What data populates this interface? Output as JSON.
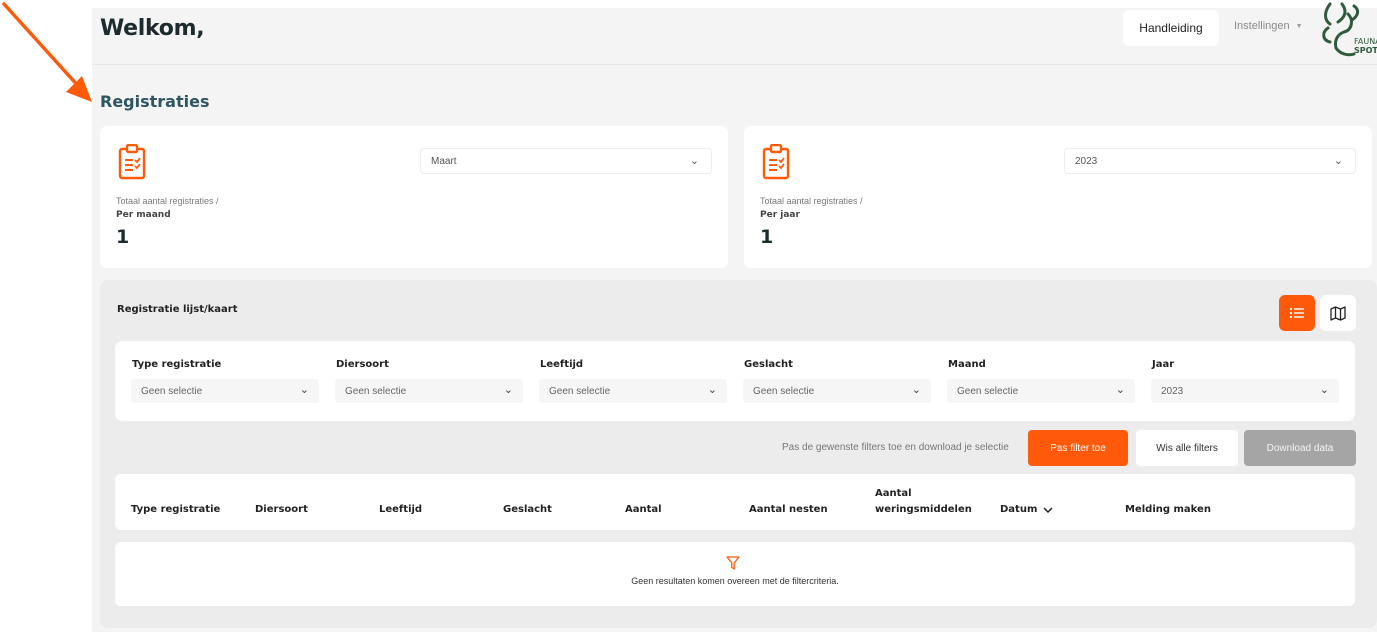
{
  "header": {
    "welcome": "Welkom,",
    "manual_label": "Handleiding",
    "settings_label": "Instellingen",
    "logo_text_1": "FAUNA",
    "logo_text_2": "SPOT"
  },
  "section_title": "Registraties",
  "cards": [
    {
      "select_value": "Maart",
      "label": "Totaal aantal registraties /",
      "sublabel": "Per maand",
      "value": "1"
    },
    {
      "select_value": "2023",
      "label": "Totaal aantal registraties /",
      "sublabel": "Per jaar",
      "value": "1"
    }
  ],
  "panel": {
    "title": "Registratie lijst/kaart",
    "filters": [
      {
        "label": "Type registratie",
        "value": "Geen selectie"
      },
      {
        "label": "Diersoort",
        "value": "Geen selectie"
      },
      {
        "label": "Leeftijd",
        "value": "Geen selectie"
      },
      {
        "label": "Geslacht",
        "value": "Geen selectie"
      },
      {
        "label": "Maand",
        "value": "Geen selectie"
      },
      {
        "label": "Jaar",
        "value": "2023"
      }
    ],
    "hint": "Pas de gewenste filters toe en download je selectie",
    "apply_label": "Pas filter toe",
    "clear_label": "Wis alle filters",
    "download_label": "Download data",
    "columns": [
      "Type registratie",
      "Diersoort",
      "Leeftijd",
      "Geslacht",
      "Aantal",
      "Aantal nesten",
      "Aantal",
      "weringsmiddelen",
      "Datum",
      "Melding maken"
    ],
    "empty_message": "Geen resultaten komen overeen met de filtercriteria."
  },
  "colors": {
    "accent": "#ff5a0a",
    "title_teal": "#2f5562",
    "logo_green": "#2f5a3c"
  },
  "icons": [
    "clipboard-icon",
    "chevron-down-icon",
    "list-icon",
    "map-icon",
    "filter-icon",
    "arrow-annotation-icon"
  ]
}
